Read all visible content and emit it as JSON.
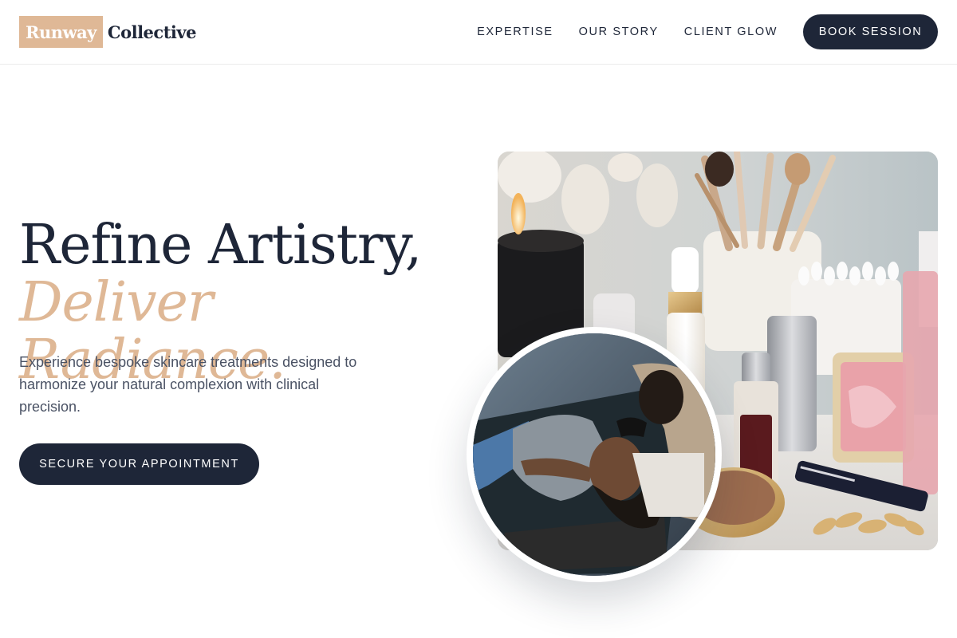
{
  "brand": {
    "logo_box": "Runway",
    "logo_text": "Collective"
  },
  "nav": {
    "links": [
      "EXPERTISE",
      "OUR STORY",
      "CLIENT GLOW"
    ],
    "cta": "BOOK SESSION"
  },
  "hero": {
    "title_line1": "Refine Artistry,",
    "title_line2": "Deliver Radiance.",
    "subtitle": "Experience bespoke skincare treatments designed to harmonize your natural complexion with clinical precision.",
    "cta": "SECURE YOUR APPOINTMENT"
  },
  "colors": {
    "navy": "#1e2638",
    "accent": "#dfb896",
    "body_text": "#4a5264"
  }
}
